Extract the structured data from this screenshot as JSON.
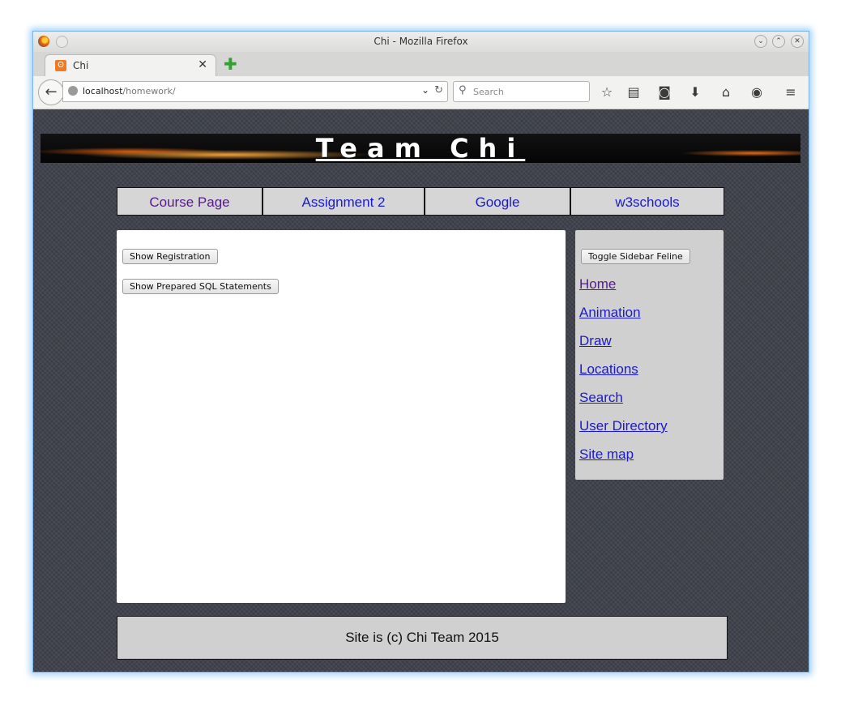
{
  "window": {
    "title": "Chi - Mozilla Firefox"
  },
  "tab": {
    "title": "Chi"
  },
  "urlbar": {
    "host": "localhost",
    "path": "/homework/"
  },
  "searchbar": {
    "placeholder": "Search"
  },
  "banner": {
    "title": "Team Chi"
  },
  "menu": [
    {
      "label": "Course Page",
      "visited": true
    },
    {
      "label": "Assignment 2",
      "visited": false
    },
    {
      "label": "Google",
      "visited": false
    },
    {
      "label": "w3schools",
      "visited": false
    }
  ],
  "main": {
    "show_registration": "Show Registration",
    "show_sql": "Show Prepared SQL Statements"
  },
  "sidebar": {
    "toggle_label": "Toggle Sidebar Feline",
    "links": [
      "Home",
      "Animation",
      "Draw",
      "Locations",
      "Search",
      "User Directory",
      "Site map"
    ]
  },
  "footer": {
    "text": "Site is (c) Chi Team 2015"
  },
  "colors": {
    "link": "#1a1acc",
    "visited": "#551a8b",
    "page_bg": "#3d4049"
  }
}
